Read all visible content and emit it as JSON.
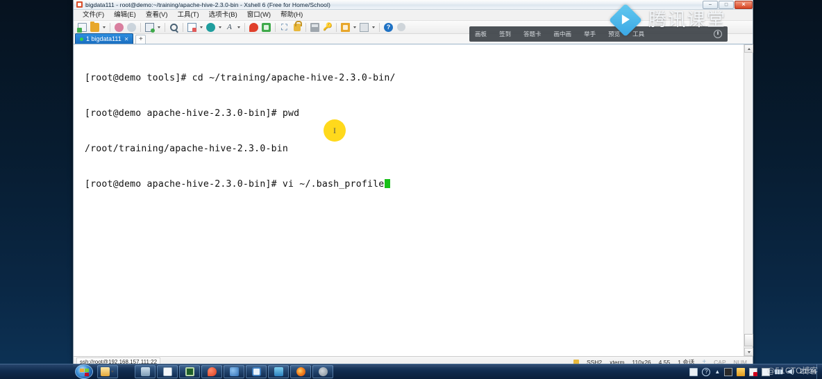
{
  "window": {
    "title": "bigdata111 - root@demo:~/training/apache-hive-2.3.0-bin - Xshell 6 (Free for Home/School)",
    "icon": "xshell-icon",
    "controls": {
      "minimize": "–",
      "maximize": "□",
      "close": "✕"
    }
  },
  "menu": {
    "items": [
      {
        "label": "文件(F)",
        "name": "menu-file"
      },
      {
        "label": "编辑(E)",
        "name": "menu-edit"
      },
      {
        "label": "查看(V)",
        "name": "menu-view"
      },
      {
        "label": "工具(T)",
        "name": "menu-tools"
      },
      {
        "label": "选项卡(B)",
        "name": "menu-tab"
      },
      {
        "label": "窗口(W)",
        "name": "menu-window"
      },
      {
        "label": "帮助(H)",
        "name": "menu-help"
      }
    ]
  },
  "toolbar": {
    "buttons": [
      {
        "name": "new-session-icon",
        "glyph": "new-file"
      },
      {
        "name": "open-folder-icon",
        "glyph": "folder"
      },
      {
        "name": "connect-icon",
        "glyph": "net"
      },
      {
        "name": "disconnect-icon",
        "glyph": "net2"
      },
      {
        "name": "properties-icon",
        "glyph": "prop"
      },
      {
        "name": "find-icon",
        "glyph": "search"
      },
      {
        "name": "session-log-icon",
        "glyph": "book"
      },
      {
        "name": "highlight-icon",
        "glyph": "circle-teal"
      },
      {
        "name": "font-size-icon",
        "glyph": "font"
      },
      {
        "name": "transfer-zmodem-icon",
        "glyph": "red"
      },
      {
        "name": "sftp-icon",
        "glyph": "green"
      },
      {
        "name": "fullscreen-icon",
        "glyph": "expand"
      },
      {
        "name": "lock-icon",
        "glyph": "lock"
      },
      {
        "name": "tray-icon",
        "glyph": "tray"
      },
      {
        "name": "key-manager-icon",
        "glyph": "key"
      },
      {
        "name": "capture-icon",
        "glyph": "capture"
      },
      {
        "name": "layout-icon",
        "glyph": "grid"
      },
      {
        "name": "help-icon",
        "glyph": "help"
      },
      {
        "name": "disabled-icon",
        "glyph": "dim"
      }
    ]
  },
  "tabs": {
    "items": [
      {
        "label": "1 bigdata111",
        "close": "✕",
        "status": "connected"
      }
    ],
    "add_label": "+"
  },
  "terminal": {
    "lines": [
      "[root@demo tools]# cd ~/training/apache-hive-2.3.0-bin/",
      "[root@demo apache-hive-2.3.0-bin]# pwd",
      "/root/training/apache-hive-2.3.0-bin",
      "[root@demo apache-hive-2.3.0-bin]# vi ~/.bash_profile"
    ],
    "cursor_color": "#18c018",
    "background": "#ffffff",
    "foreground": "#111111"
  },
  "statusbar": {
    "connection": "ssh://root@192.168.157.111:22",
    "protocol": "SSH2",
    "term_type": "xterm",
    "size": "110x26",
    "position": "4,55",
    "sessions": "1 会话",
    "caps": "CAP",
    "num": "NUM",
    "plus": "+"
  },
  "tencent_overlay": {
    "items": [
      "画板",
      "签到",
      "答题卡",
      "画中画",
      "举手",
      "预览",
      "工具"
    ],
    "brand": "腾讯课堂",
    "power_icon": "power-icon",
    "logo_icon": "play-diamond-icon"
  },
  "cursor": {
    "glyph": "I",
    "halo_color": "#ffd91c"
  },
  "taskbar": {
    "start": "start-orb",
    "apps": [
      {
        "name": "taskbar-explorer",
        "glyph": "explorer"
      },
      {
        "name": "taskbar-media-player",
        "glyph": "media"
      },
      {
        "name": "taskbar-notepad",
        "glyph": "note"
      },
      {
        "name": "taskbar-vmware",
        "glyph": "vm"
      },
      {
        "name": "taskbar-app-red",
        "glyph": "red"
      },
      {
        "name": "taskbar-app-blue",
        "glyph": "blue2"
      },
      {
        "name": "taskbar-camera",
        "glyph": "cam"
      },
      {
        "name": "taskbar-app-teal",
        "glyph": "teal"
      },
      {
        "name": "taskbar-firefox",
        "glyph": "ff"
      },
      {
        "name": "taskbar-app-gray",
        "glyph": "gray"
      }
    ],
    "tray": [
      {
        "name": "tray-keyboard-icon",
        "glyph": "kb"
      },
      {
        "name": "tray-help-icon",
        "glyph": "help",
        "text": "?"
      },
      {
        "name": "tray-expand-icon",
        "glyph": "up",
        "text": "▲"
      },
      {
        "name": "tray-recorder-icon",
        "glyph": "film"
      },
      {
        "name": "tray-yellow-icon",
        "glyph": "yellow"
      },
      {
        "name": "tray-antivirus-icon",
        "glyph": "red"
      },
      {
        "name": "tray-doc-icon",
        "glyph": "doc"
      },
      {
        "name": "tray-network-icon",
        "glyph": "sig",
        "text": "▮▮▮"
      },
      {
        "name": "tray-volume-icon",
        "glyph": "vol",
        "text": "◀)"
      }
    ],
    "clock": "21:34"
  },
  "watermark": "@51CTO博客"
}
